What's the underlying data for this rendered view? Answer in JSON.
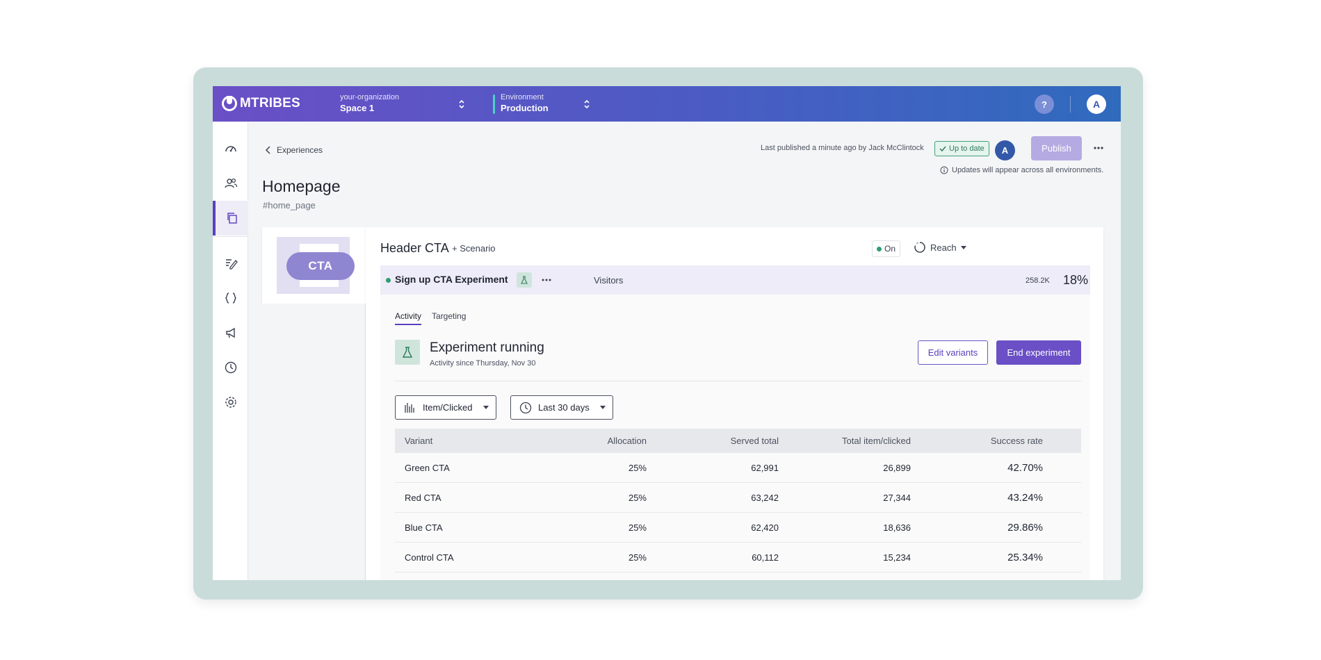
{
  "topbar": {
    "logo": "MTRIBES",
    "org_label": "your-organization",
    "space_value": "Space 1",
    "env_label": "Environment",
    "env_value": "Production",
    "help": "?",
    "avatar": "A"
  },
  "header": {
    "back_label": "Experiences",
    "title": "Homepage",
    "slug": "#home_page",
    "published": "Last published a minute ago by Jack McClintock",
    "status_badge": "Up to date",
    "avatar": "A",
    "publish_label": "Publish",
    "updates_note": "Updates will appear across all environments."
  },
  "thumbnail": {
    "label": "CTA"
  },
  "card": {
    "title": "Header CTA",
    "add_scenario": "+ Scenario",
    "on_label": "On",
    "reach_label": "Reach"
  },
  "experiment": {
    "name": "Sign up CTA Experiment",
    "audience": "Visitors",
    "count": "258.2K",
    "percent": "18%"
  },
  "panel": {
    "tabs": [
      "Activity",
      "Targeting"
    ],
    "status_title": "Experiment running",
    "status_sub": "Activity since Thursday, Nov 30",
    "edit_label": "Edit variants",
    "end_label": "End experiment",
    "metric_select": "Item/Clicked",
    "range_select": "Last 30 days"
  },
  "table": {
    "headers": [
      "Variant",
      "Allocation",
      "Served total",
      "Total item/clicked",
      "Success rate"
    ],
    "rows": [
      [
        "Green CTA",
        "25%",
        "62,991",
        "26,899",
        "42.70%"
      ],
      [
        "Red CTA",
        "25%",
        "63,242",
        "27,344",
        "43.24%"
      ],
      [
        "Blue CTA",
        "25%",
        "62,420",
        "18,636",
        "29.86%"
      ],
      [
        "Control CTA",
        "25%",
        "60,112",
        "15,234",
        "25.34%"
      ]
    ]
  },
  "colors": {
    "brand": "#6a4fc6",
    "topbar_end": "#2f6bbd",
    "success": "#2f9e6f"
  },
  "icons": [
    "dashboard-icon",
    "users-icon",
    "copy-icon",
    "edit-icon",
    "braces-icon",
    "megaphone-icon",
    "clock-icon",
    "gear-icon",
    "flask-icon",
    "bar-chart-icon",
    "more-icon",
    "info-icon",
    "check-icon",
    "reach-icon"
  ]
}
